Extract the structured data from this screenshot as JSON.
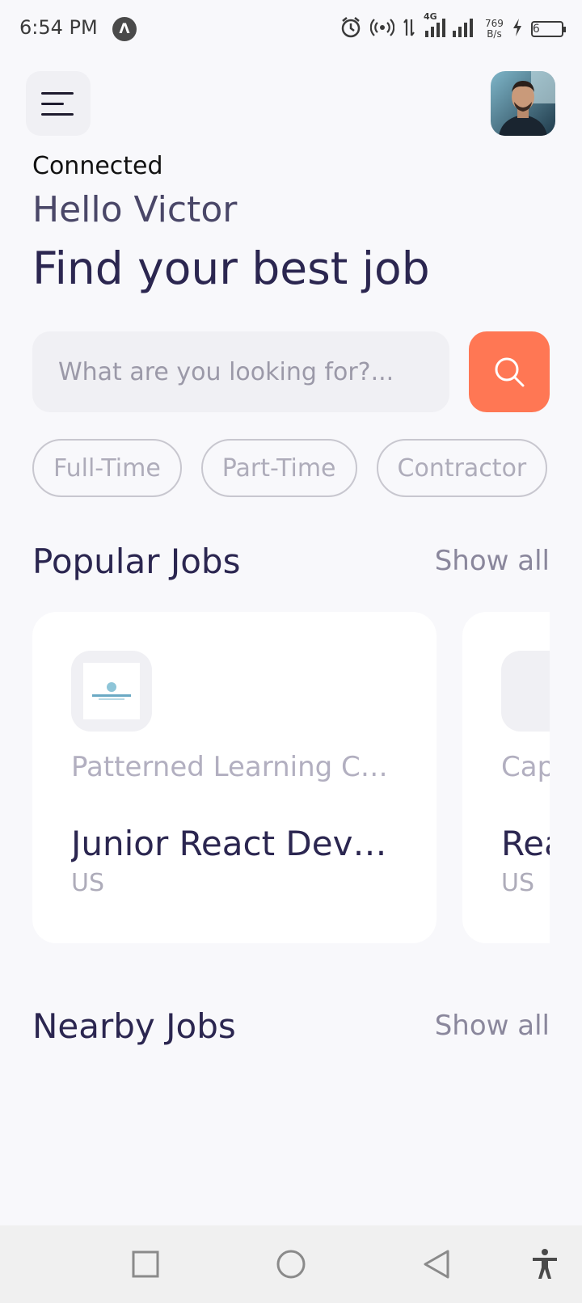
{
  "status_bar": {
    "time": "6:54 PM",
    "net_speed_value": "769",
    "net_speed_unit": "B/s",
    "network_type": "4G",
    "battery": "6"
  },
  "header": {
    "status": "Connected",
    "greeting": "Hello Victor",
    "headline": "Find your best job"
  },
  "search": {
    "placeholder": "What are you looking for?..."
  },
  "job_types": [
    "Full-Time",
    "Part-Time",
    "Contractor"
  ],
  "popular": {
    "title": "Popular Jobs",
    "show_all": "Show all",
    "cards": [
      {
        "company": "Patterned Learning Car...",
        "title": "Junior React Devel...",
        "country": "US"
      },
      {
        "company": "Cap",
        "title": "Rea",
        "country": "US"
      }
    ]
  },
  "nearby": {
    "title": "Nearby Jobs",
    "show_all": "Show all"
  },
  "colors": {
    "accent": "#ff7754",
    "primary_text": "#2b2650",
    "muted_text": "#aeacba"
  },
  "icons": {
    "menu": "menu-icon",
    "search": "search-icon",
    "nav_recent": "square-icon",
    "nav_home": "circle-icon",
    "nav_back": "triangle-back-icon",
    "accessibility": "accessibility-icon"
  }
}
